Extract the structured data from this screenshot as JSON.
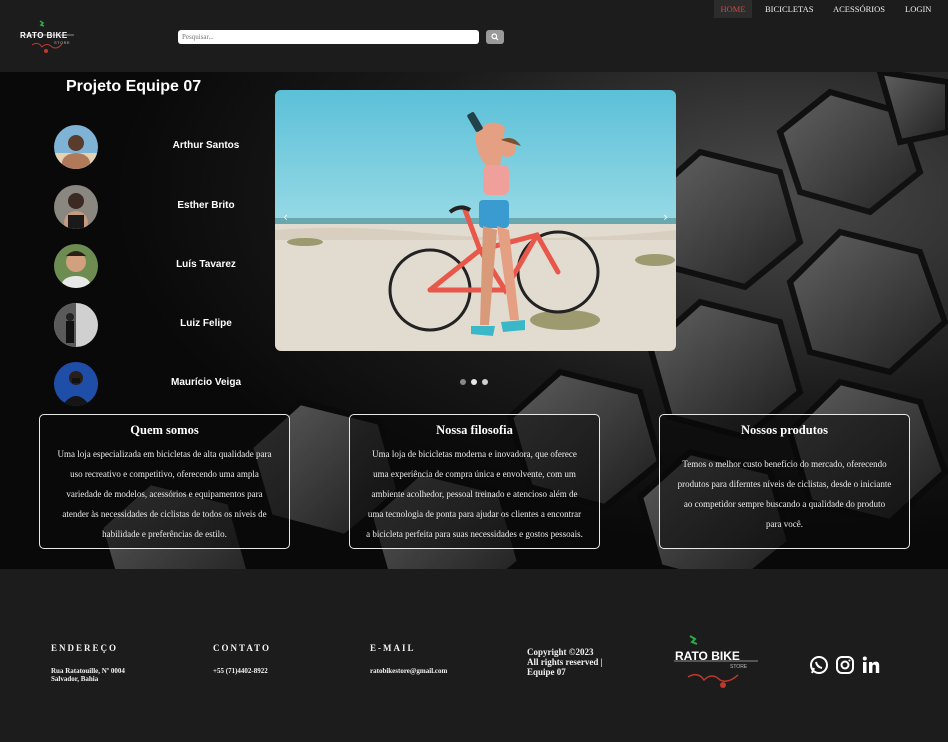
{
  "header": {
    "logo_text": "RATO BIKE",
    "logo_sub": "STORE",
    "search_placeholder": "Pesquisar...",
    "nav": [
      "HOME",
      "BICICLETAS",
      "ACESSÓRIOS",
      "LOGIN"
    ],
    "active_color": "#d9453b"
  },
  "team": {
    "title": "Projeto Equipe 07",
    "members": [
      "Arthur Santos",
      "Esther Brito",
      "Luís Tavarez",
      "Luiz Felipe",
      "Maurício Veiga"
    ]
  },
  "carousel": {
    "prev_icon": "chevron-left-icon",
    "next_icon": "chevron-right-icon",
    "slides": 3,
    "active": 1
  },
  "cards": [
    {
      "title": "Quem somos",
      "lines": [
        "Uma loja especializada em bicicletas de alta qualidade para",
        "uso recreativo e competitivo, oferecendo uma ampla",
        "variedade de modelos, acessórios e equipamentos para",
        "atender às necessidades de ciclistas de todos os níveis de",
        "habilidade e preferências de estilo."
      ]
    },
    {
      "title": "Nossa filosofia",
      "lines": [
        "Uma loja de bicicletas moderna e inovadora, que oferece",
        "uma experiência de compra única e envolvente, com um",
        "ambiente acolhedor, pessoal treinado e atencioso além de",
        "uma tecnologia de ponta para ajudar os clientes a encontrar",
        "a bicicleta perfeita para suas necessidades e gostos pessoais."
      ]
    },
    {
      "title": "Nossos produtos",
      "lines": [
        "Temos o melhor custo benefício do mercado, oferecendo",
        "produtos para diferntes níveis de ciclistas, desde o iniciante",
        "ao competidor sempre buscando a qualidade do produto",
        "para você."
      ]
    }
  ],
  "footer": {
    "address_title": "ENDEREÇO",
    "address_line1": "Rua Ratatouille, Nº 0004",
    "address_line2": "Salvador, Bahia",
    "contact_title": "CONTATO",
    "contact_phone": "+55 (71)4402-8922",
    "email_title": "E-MAIL",
    "email": "ratobikestore@gmail.com",
    "copyright_line1": "Copyright ©2023",
    "copyright_line2": "All rights reserved |",
    "copyright_line3": "Equipe 07",
    "logo_text": "RATO BIKE",
    "logo_sub": "STORE",
    "social_icons": [
      "whatsapp-icon",
      "instagram-icon",
      "linkedin-icon"
    ]
  }
}
